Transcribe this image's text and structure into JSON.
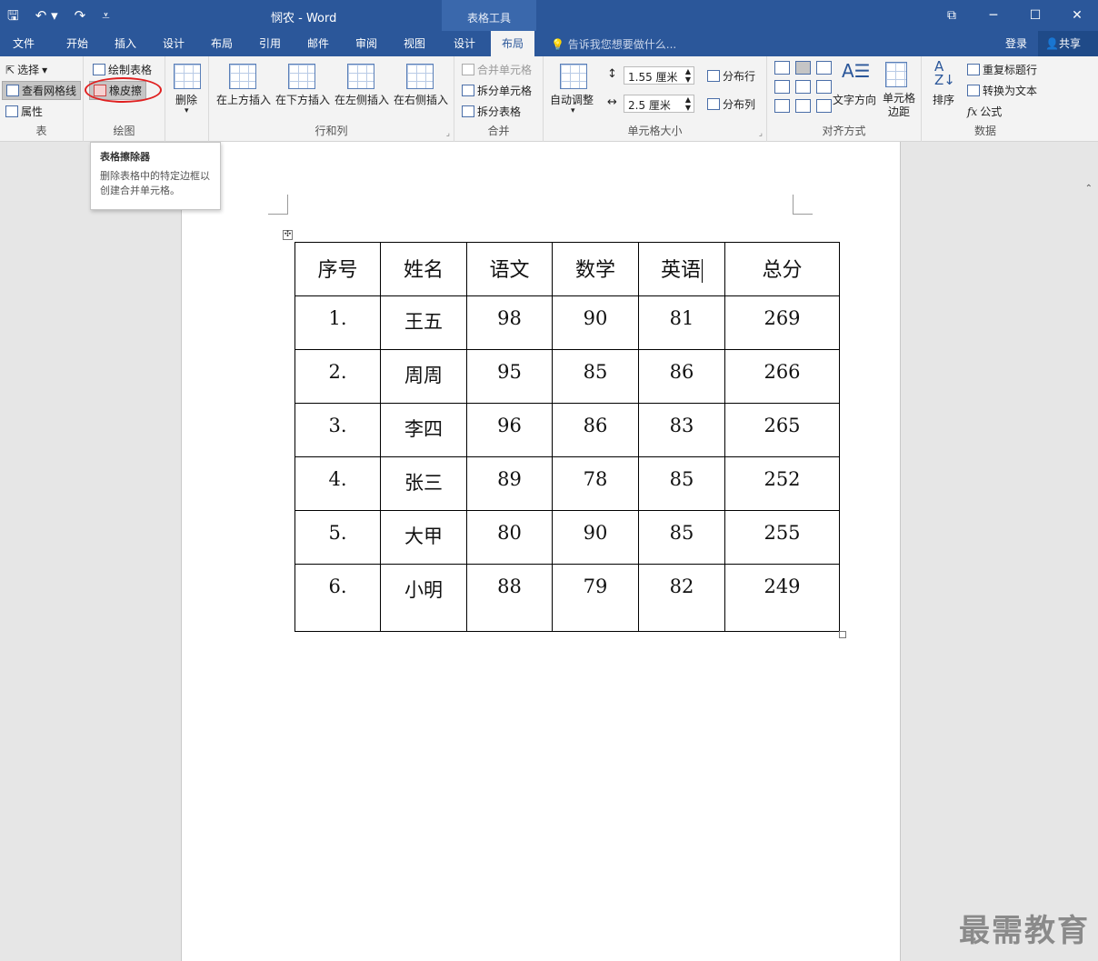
{
  "titlebar": {
    "title": "悯农 - Word",
    "context_header": "表格工具",
    "qat": [
      "save-icon",
      "undo-icon",
      "redo-icon",
      "customize-icon"
    ]
  },
  "tabs": [
    {
      "label": "文件",
      "active": false
    },
    {
      "label": "开始",
      "active": false
    },
    {
      "label": "插入",
      "active": false
    },
    {
      "label": "设计",
      "active": false
    },
    {
      "label": "布局",
      "active": false
    },
    {
      "label": "引用",
      "active": false
    },
    {
      "label": "邮件",
      "active": false
    },
    {
      "label": "审阅",
      "active": false
    },
    {
      "label": "视图",
      "active": false
    },
    {
      "label": "设计",
      "active": false
    },
    {
      "label": "布局",
      "active": true
    }
  ],
  "tell_me": "告诉我您想要做什么...",
  "login": "登录",
  "share": "共享",
  "ribbon": {
    "table_group": {
      "label": "表",
      "select": "选择",
      "view_gridlines": "查看网格线",
      "properties": "属性"
    },
    "draw_group": {
      "label": "绘图",
      "draw_table": "绘制表格",
      "eraser": "橡皮擦"
    },
    "delete": "删除",
    "rows_cols": {
      "label": "行和列",
      "insert_above": "在上方插入",
      "insert_below": "在下方插入",
      "insert_left": "在左侧插入",
      "insert_right": "在右侧插入"
    },
    "merge": {
      "label": "合并",
      "merge_cells": "合并单元格",
      "split_cells": "拆分单元格",
      "split_table": "拆分表格"
    },
    "cell_size": {
      "label": "单元格大小",
      "autofit": "自动调整",
      "height": "1.55 厘米",
      "width": "2.5 厘米",
      "distribute_rows": "分布行",
      "distribute_cols": "分布列"
    },
    "alignment": {
      "label": "对齐方式",
      "text_direction": "文字方向",
      "cell_margins": "单元格\n边距"
    },
    "data": {
      "label": "数据",
      "sort": "排序",
      "repeat_header": "重复标题行",
      "convert_text": "转换为文本",
      "formula": "公式"
    }
  },
  "tooltip": {
    "title": "表格擦除器",
    "body": "删除表格中的特定边框以创建合并单元格。"
  },
  "table": {
    "headers": [
      "序号",
      "姓名",
      "语文",
      "数学",
      "英语",
      "总分"
    ],
    "rows": [
      [
        "1.",
        "王五",
        "98",
        "90",
        "81",
        "269"
      ],
      [
        "2.",
        "周周",
        "95",
        "85",
        "86",
        "266"
      ],
      [
        "3.",
        "李四",
        "96",
        "86",
        "83",
        "265"
      ],
      [
        "4.",
        "张三",
        "89",
        "78",
        "85",
        "252"
      ],
      [
        "5.",
        "大甲",
        "80",
        "90",
        "85",
        "255"
      ],
      [
        "6.",
        "小明",
        "88",
        "79",
        "82",
        "249"
      ]
    ]
  },
  "watermark": "最需教育"
}
